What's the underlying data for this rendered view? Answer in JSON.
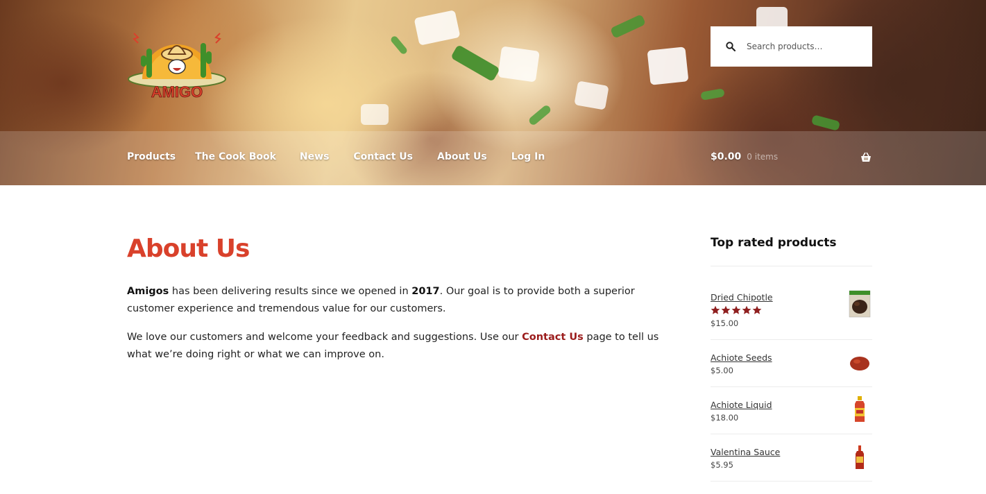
{
  "header": {
    "logo_text": "AMIGO",
    "search_placeholder": "Search products…",
    "nav": [
      {
        "label": "Products"
      },
      {
        "label": "The Cook Book"
      },
      {
        "label": "News"
      },
      {
        "label": "Contact Us"
      },
      {
        "label": "About Us"
      },
      {
        "label": "Log In"
      }
    ],
    "cart": {
      "amount": "$0.00",
      "count": "0 items",
      "icon": "basket-icon"
    }
  },
  "page": {
    "title": "About Us",
    "p1": {
      "brand": "Amigos",
      "before_year": " has been delivering results since we opened in ",
      "year": "2017",
      "after_year": ". Our goal is to provide both a superior customer experience and tremendous value for our customers."
    },
    "p2": {
      "before_link": "We love our customers and welcome your feedback and suggestions. Use our ",
      "link": "Contact Us",
      "after_link": " page to tell us what we’re doing right or what we can improve on."
    }
  },
  "sidebar": {
    "title": "Top rated products",
    "products": [
      {
        "name": "Dried Chipotle",
        "price": "$15.00",
        "rating": 5
      },
      {
        "name": "Achiote Seeds",
        "price": "$5.00"
      },
      {
        "name": "Achiote Liquid",
        "price": "$18.00"
      },
      {
        "name": "Valentina Sauce",
        "price": "$5.95"
      }
    ]
  },
  "colors": {
    "accent": "#d9412b",
    "link": "#9b1c1c",
    "star": "#8f1f1f"
  }
}
